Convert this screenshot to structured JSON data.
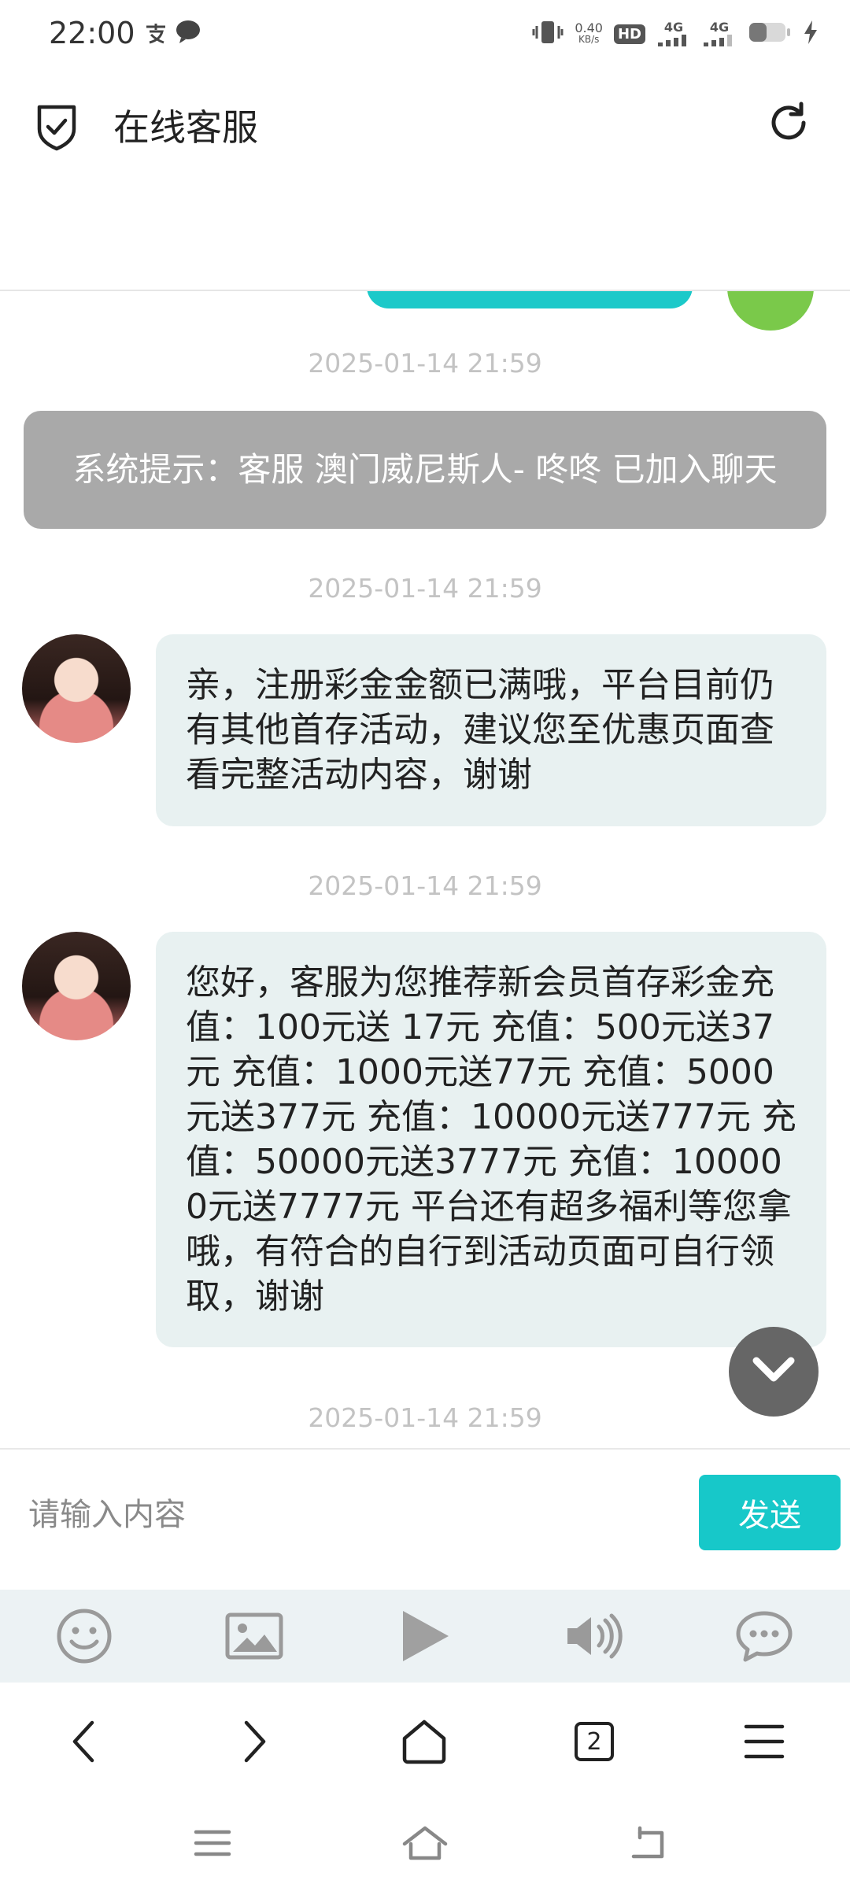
{
  "status_bar": {
    "time": "22:00",
    "net_speed_value": "0.40",
    "net_speed_unit": "KB/s",
    "hd_label": "HD",
    "signal1_label": "4G",
    "signal2_label": "4G",
    "left_icons": [
      "alipay-icon",
      "chat-bubble-icon"
    ],
    "right_icons": [
      "vibrate-icon",
      "hd-icon",
      "signal-4g-icon",
      "signal-4g-icon",
      "battery-icon",
      "charging-icon"
    ]
  },
  "header": {
    "title": "在线客服",
    "left_icon": "shield-check-icon",
    "right_icon": "refresh-icon"
  },
  "chat": {
    "messages": [
      {
        "type": "timestamp",
        "text": "2025-01-14 21:59"
      },
      {
        "type": "system",
        "text": "系统提示：客服 澳门威尼斯人- 咚咚 已加入聊天"
      },
      {
        "type": "timestamp",
        "text": "2025-01-14 21:59"
      },
      {
        "type": "agent",
        "text": "亲，注册彩金金额已满哦，平台目前仍有其他首存活动，建议您至优惠页面查看完整活动内容，谢谢"
      },
      {
        "type": "timestamp",
        "text": "2025-01-14 21:59"
      },
      {
        "type": "agent",
        "text": "您好，客服为您推荐新会员首存彩金充值：100元送 17元 充值：500元送37元 充值：1000元送77元 充值：5000元送377元 充值：10000元送777元 充值：50000元送3777元 充值：100000元送7777元 平台还有超多福利等您拿哦，有符合的自行到活动页面可自行领取，谢谢"
      },
      {
        "type": "timestamp",
        "text": "2025-01-14 21:59"
      }
    ],
    "scroll_icon": "chevron-down-icon"
  },
  "input": {
    "placeholder": "请输入内容",
    "value": "",
    "send_label": "发送"
  },
  "toolbar": {
    "icons": [
      "emoji-icon",
      "image-icon",
      "video-icon",
      "audio-icon",
      "comment-icon"
    ]
  },
  "browser_nav": {
    "tab_count": "2",
    "icons": [
      "back-icon",
      "forward-icon",
      "home-icon",
      "tabs-icon",
      "menu-icon"
    ]
  },
  "system_nav": {
    "icons": [
      "recent-apps-icon",
      "home-icon",
      "back-icon"
    ]
  },
  "colors": {
    "accent": "#17c8c9",
    "system_bubble": "#a9a9a9",
    "agent_bubble": "#e8f1f1",
    "toolbar_bg": "#ecf2f4",
    "timestamp": "#c3c3c3"
  }
}
